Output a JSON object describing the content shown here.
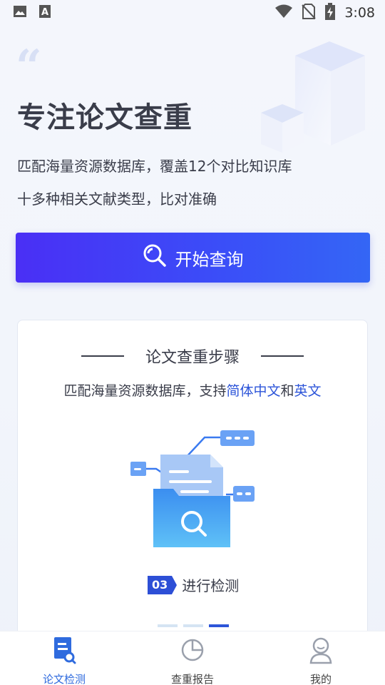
{
  "status_bar": {
    "time": "3:08",
    "left_icons": [
      "image-icon",
      "text-a-icon"
    ],
    "right_icons": [
      "wifi-icon",
      "no-sim-icon",
      "battery-charging-icon"
    ]
  },
  "hero": {
    "title": "专注论文查重",
    "line1": "匹配海量资源数据库，覆盖12个对比知识库",
    "line2": "十多种相关文献类型，比对准确"
  },
  "start_button": {
    "label": "开始查询",
    "icon": "search-icon"
  },
  "steps_card": {
    "title": "论文查重步骤",
    "subtitle_prefix": "匹配海量资源数据库，支持",
    "subtitle_hl1": "简体中文",
    "subtitle_mid": "和",
    "subtitle_hl2": "英文",
    "step_number": "03",
    "step_text": "进行检测",
    "pager": {
      "count": 3,
      "active_index": 2
    }
  },
  "tab_bar": {
    "tabs": [
      {
        "label": "论文检测",
        "icon": "document-search-icon",
        "active": true
      },
      {
        "label": "查重报告",
        "icon": "pie-chart-icon",
        "active": false
      },
      {
        "label": "我的",
        "icon": "user-icon",
        "active": false
      }
    ]
  },
  "colors": {
    "accent": "#2d55d9",
    "button_gradient_start": "#4a2ff5",
    "button_gradient_end": "#3466f5",
    "active_tab": "#2f6bde"
  }
}
